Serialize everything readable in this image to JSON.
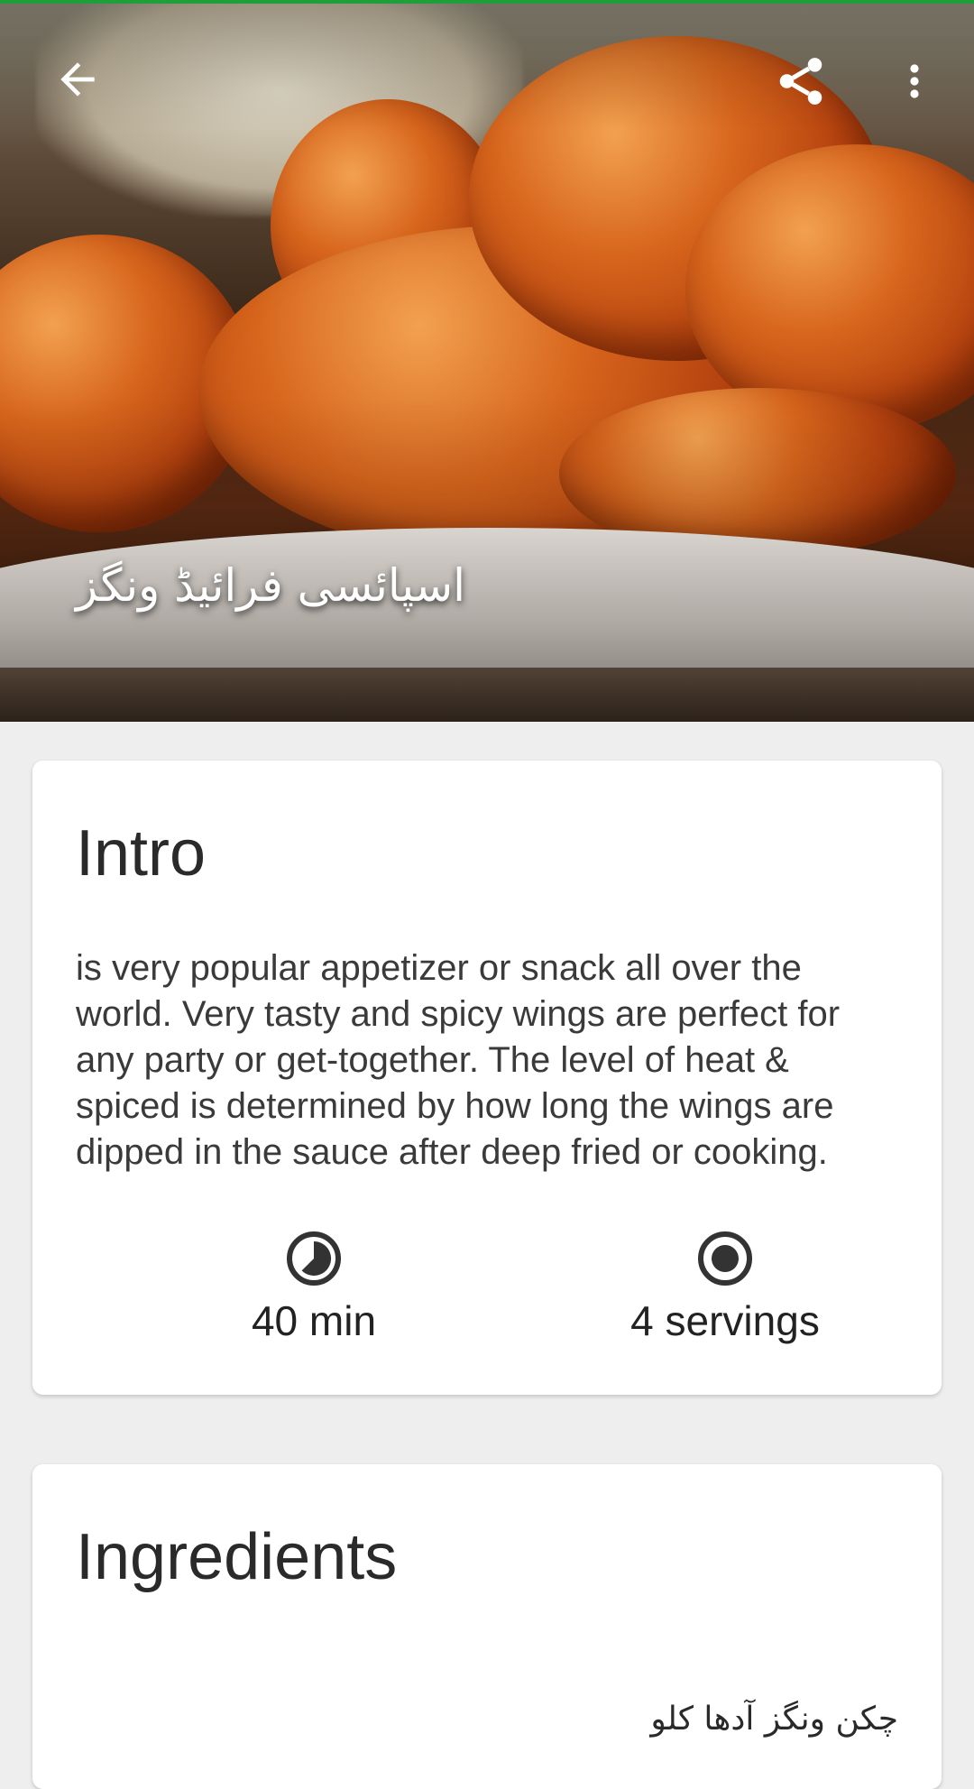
{
  "app_bar": {
    "back_icon": "arrow-back-icon",
    "share_icon": "share-icon",
    "more_icon": "more-vert-icon",
    "status_line_color": "#1f9f3a"
  },
  "hero": {
    "title": "اسپائسی فرائیڈ ونگز"
  },
  "intro": {
    "heading": "Intro",
    "description": "is very popular appetizer or snack all over the world. Very tasty and spicy wings are perfect for any party or get-together. The level of heat & spiced is determined by how long the wings are dipped in the sauce after deep fried or cooking.",
    "time": {
      "icon": "timer-icon",
      "label": "40 min"
    },
    "servings": {
      "icon": "servings-icon",
      "label": "4 servings"
    }
  },
  "ingredients": {
    "heading": "Ingredients",
    "items": [
      "چکن ونگز آدھا کلو"
    ]
  }
}
